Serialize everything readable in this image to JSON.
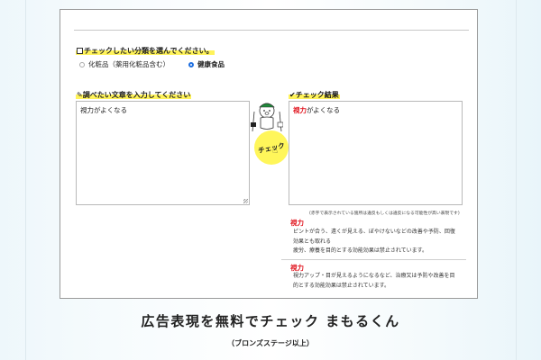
{
  "category": {
    "heading": "チェックしたい分類を選んでください。",
    "options": [
      {
        "label": "化粧品（薬用化粧品含む）",
        "selected": false
      },
      {
        "label": "健康食品",
        "selected": true
      }
    ]
  },
  "input": {
    "heading": "調べたい文章を入力してください",
    "value": "視力がよくなる"
  },
  "result": {
    "heading": "✔チェック結果",
    "highlighted_term": "視力",
    "rest_text": "がよくなる",
    "note": "(赤字で表示されている箇所は違反もしくは違反になる可能性が高い表現です)",
    "entries": [
      {
        "term": "視力",
        "lines": [
          "ピントが合う、遠くが見える、ぼやけないなどの改善や予防、回復",
          "効果とも取れる",
          "疲労、療養を目的とする効能効果は禁止されています。"
        ]
      },
      {
        "term": "視力",
        "lines": [
          "視力アップ・目が見えるようになるなど、治療又は予防や改善を目",
          "的とする効能効果は禁止されています。"
        ]
      }
    ]
  },
  "check_button": {
    "label": "チェック"
  },
  "page": {
    "title": "広告表現を無料でチェック まもるくん",
    "subtitle": "（ブロンズステージ以上）"
  },
  "colors": {
    "highlight": "#fff35a",
    "error_red": "#e0101a",
    "radio_blue": "#1f6fe0"
  },
  "icons": [
    "checkbox-icon",
    "pencil-icon",
    "bear-mascot-icon",
    "pointer-hand-icon"
  ]
}
